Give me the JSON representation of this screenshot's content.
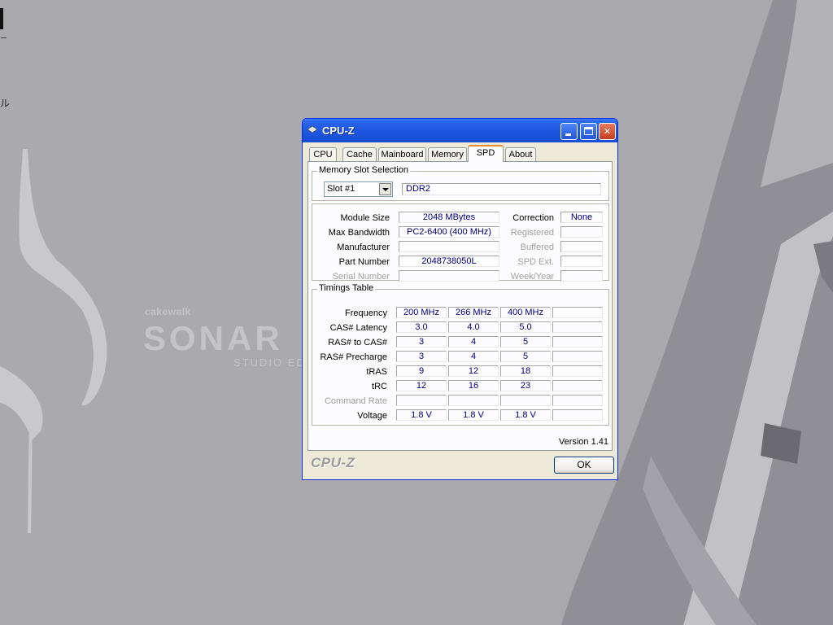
{
  "desktop": {
    "frag_text_1": "ー",
    "frag_text_2": "ル",
    "sonar": {
      "brand": "cakewalk",
      "name": "SONAR",
      "edition": "STUDIO ED"
    }
  },
  "window": {
    "title": "CPU-Z",
    "tabs": [
      {
        "label": "CPU"
      },
      {
        "label": "Cache"
      },
      {
        "label": "Mainboard"
      },
      {
        "label": "Memory"
      },
      {
        "label": "SPD",
        "active": true
      },
      {
        "label": "About"
      }
    ],
    "slot_group": {
      "label": "Memory Slot Selection",
      "slot_value": "Slot #1",
      "memory_type": "DDR2"
    },
    "module": {
      "module_size_label": "Module Size",
      "module_size": "2048 MBytes",
      "max_bandwidth_label": "Max Bandwidth",
      "max_bandwidth": "PC2-6400 (400 MHz)",
      "manufacturer_label": "Manufacturer",
      "manufacturer": "",
      "part_number_label": "Part Number",
      "part_number": "2048738050L",
      "serial_number_label": "Serial Number",
      "serial_number": "",
      "correction_label": "Correction",
      "correction": "None",
      "registered_label": "Registered",
      "registered": "",
      "buffered_label": "Buffered",
      "buffered": "",
      "spd_ext_label": "SPD Ext.",
      "spd_ext": "",
      "week_year_label": "Week/Year",
      "week_year": ""
    },
    "timings": {
      "label": "Timings Table",
      "rows": [
        {
          "label": "Frequency",
          "values": [
            "200 MHz",
            "266 MHz",
            "400 MHz",
            ""
          ],
          "disabled": false
        },
        {
          "label": "CAS# Latency",
          "values": [
            "3.0",
            "4.0",
            "5.0",
            ""
          ],
          "disabled": false
        },
        {
          "label": "RAS# to CAS#",
          "values": [
            "3",
            "4",
            "5",
            ""
          ],
          "disabled": false
        },
        {
          "label": "RAS# Precharge",
          "values": [
            "3",
            "4",
            "5",
            ""
          ],
          "disabled": false
        },
        {
          "label": "tRAS",
          "values": [
            "9",
            "12",
            "18",
            ""
          ],
          "disabled": false
        },
        {
          "label": "tRC",
          "values": [
            "12",
            "16",
            "23",
            ""
          ],
          "disabled": false
        },
        {
          "label": "Command Rate",
          "values": [
            "",
            "",
            "",
            ""
          ],
          "disabled": true
        },
        {
          "label": "Voltage",
          "values": [
            "1.8 V",
            "1.8 V",
            "1.8 V",
            ""
          ],
          "disabled": false
        }
      ]
    },
    "version": "Version 1.41",
    "logo": "CPU-Z",
    "ok_label": "OK"
  },
  "colors": {
    "desktop_bg": "#a9a9ae",
    "titlebar": "#1b55df",
    "value_text": "#000080",
    "active_tab_accent": "#e68b2c"
  }
}
